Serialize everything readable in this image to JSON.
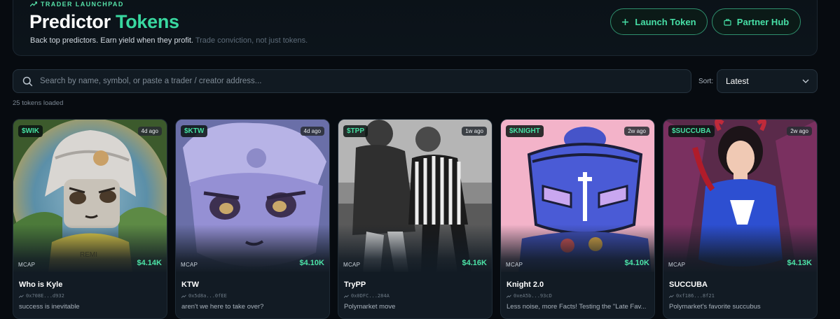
{
  "header": {
    "kicker": "TRADER LAUNCHPAD",
    "title_main": "Predictor",
    "title_accent": "Tokens",
    "subtitle": "Back top predictors. Earn yield when they profit.",
    "subtitle_muted": "Trade conviction, not just tokens.",
    "launch_label": "Launch Token",
    "partner_label": "Partner Hub"
  },
  "search": {
    "placeholder": "Search by name, symbol, or paste a trader / creator address..."
  },
  "sort": {
    "label": "Sort:",
    "value": "Latest"
  },
  "status": {
    "loaded": "25 tokens loaded"
  },
  "colors": {
    "accent": "#39d8a0",
    "background": "#070b10",
    "card": "#121b24"
  },
  "tokens": [
    {
      "symbol": "$WIK",
      "age": "4d ago",
      "mcap_label": "MCAP",
      "mcap": "$4.14K",
      "name": "Who is Kyle",
      "address": "0x708E...d932",
      "description": "success is inevitable"
    },
    {
      "symbol": "$KTW",
      "age": "4d ago",
      "mcap_label": "MCAP",
      "mcap": "$4.10K",
      "name": "KTW",
      "address": "0x5d8a...0fEE",
      "description": "aren't we here to take over?"
    },
    {
      "symbol": "$TPP",
      "age": "1w ago",
      "mcap_label": "MCAP",
      "mcap": "$4.16K",
      "name": "TryPP",
      "address": "0x0DFC...284A",
      "description": "Polymarket move"
    },
    {
      "symbol": "$KNIGHT",
      "age": "2w ago",
      "mcap_label": "MCAP",
      "mcap": "$4.10K",
      "name": "Knight 2.0",
      "address": "0xeA5b...93cD",
      "description": "Less noise, more Facts! Testing the \"Late Fav..."
    },
    {
      "symbol": "$SUCCUBA",
      "age": "2w ago",
      "mcap_label": "MCAP",
      "mcap": "$4.13K",
      "name": "SUCCUBA",
      "address": "0xf186...8f21",
      "description": "Polymarket's favorite succubus"
    }
  ]
}
